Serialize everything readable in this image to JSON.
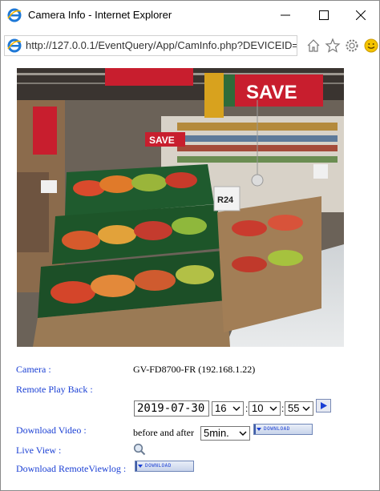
{
  "window": {
    "title": "Camera Info - Internet Explorer",
    "url": "http://127.0.0.1/EventQuery/App/CamInfo.php?DEVICEID=8"
  },
  "photo": {
    "scene": "supermarket produce aisle",
    "signs": [
      "SAVE",
      "SAVE",
      "R24"
    ]
  },
  "info": {
    "camera_label": "Camera :",
    "camera_value": "GV-FD8700-FR (192.168.1.22)",
    "playback_label": "Remote Play Back :",
    "date_value": "2019-07-30",
    "hour_value": "16",
    "minute_value": "10",
    "second_value": "55",
    "download_video_label": "Download Video :",
    "before_after_text": "before and after",
    "duration_value": "5min.",
    "download_button_text": "DOWNLOAD",
    "live_view_label": "Live View :",
    "remote_log_label": "Download RemoteViewlog :"
  },
  "colors": {
    "label_blue": "#1a3fd4",
    "ie_blue": "#1e78d6"
  }
}
